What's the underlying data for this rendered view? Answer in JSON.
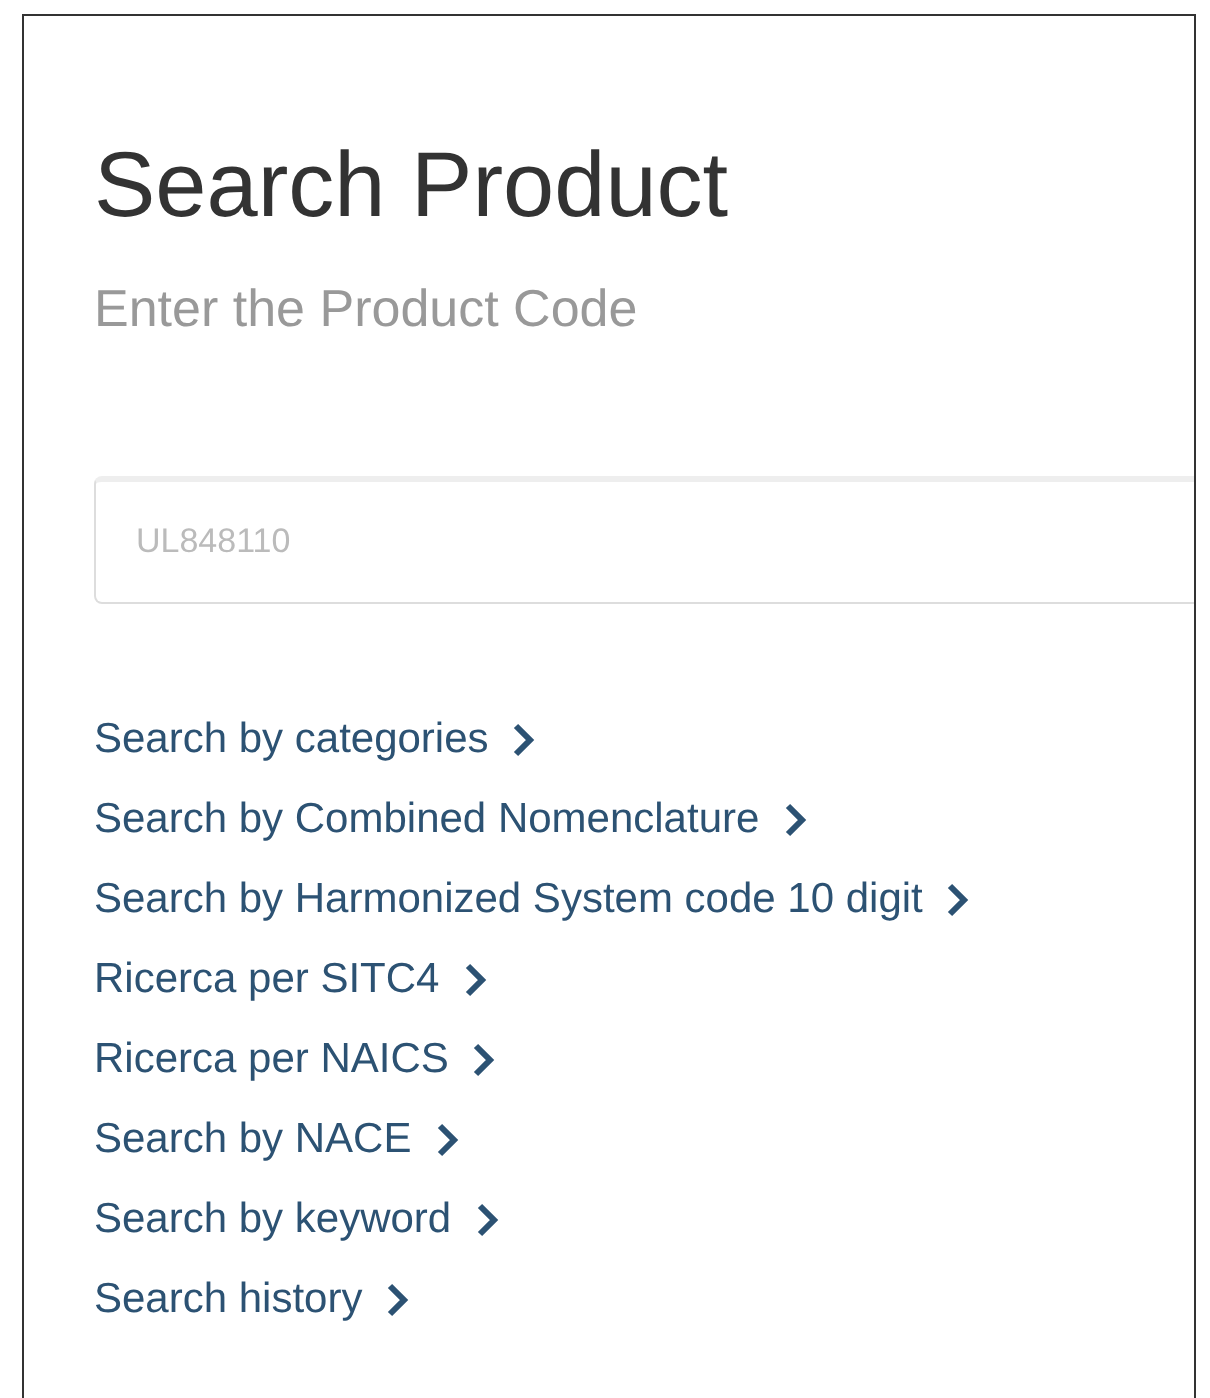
{
  "title": "Search Product",
  "subtitle": "Enter the Product Code",
  "search": {
    "placeholder": "UL848110"
  },
  "links": [
    {
      "label": "Search by categories"
    },
    {
      "label": "Search by Combined Nomenclature"
    },
    {
      "label": "Search by Harmonized System code 10 digit"
    },
    {
      "label": "Ricerca per SITC4"
    },
    {
      "label": "Ricerca per NAICS"
    },
    {
      "label": "Search by NACE"
    },
    {
      "label": "Search by keyword"
    },
    {
      "label": "Search history"
    }
  ]
}
